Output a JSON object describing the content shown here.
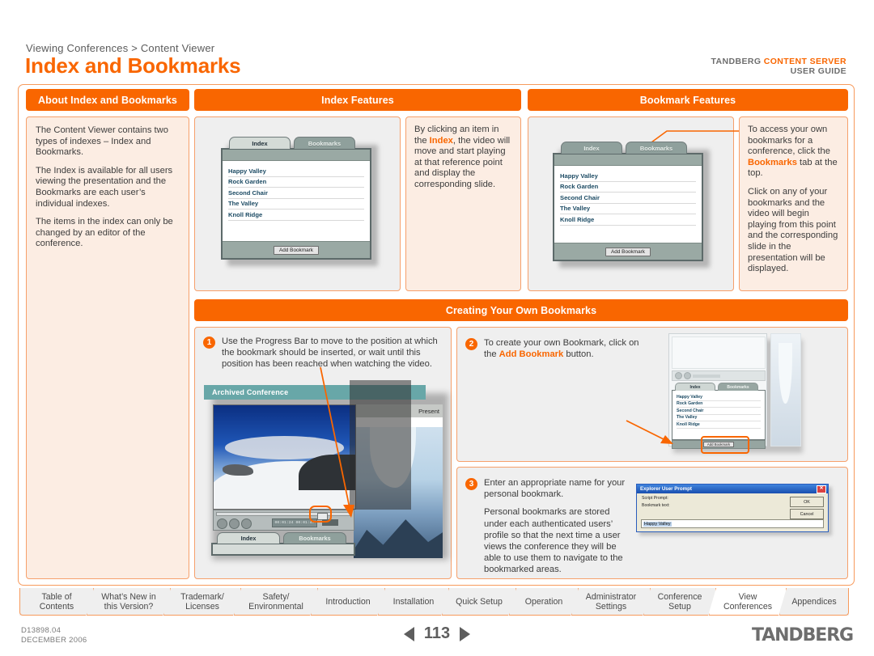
{
  "header": {
    "breadcrumb": "Viewing Conferences > Content Viewer",
    "title": "Index and Bookmarks",
    "brand_line1_prefix": "TANDBERG ",
    "brand_line1_highlight": "CONTENT SERVER",
    "brand_line2": "USER GUIDE"
  },
  "sections": {
    "about": {
      "bar_label": "About Index and Bookmarks",
      "paragraphs": [
        "The Content Viewer contains two types of indexes – Index and Bookmarks.",
        "The Index is available for all users viewing the presentation and the Bookmarks are each user’s individual indexes.",
        "The items in the index can only be changed by an editor of the conference."
      ]
    },
    "index_features": {
      "bar_label": "Index Features",
      "text_pre": "By clicking an item in the ",
      "text_highlight": "Index",
      "text_post": ", the video will move and start playing at that reference point and display the corresponding slide."
    },
    "bookmark_features": {
      "bar_label": "Bookmark Features",
      "p1_pre": "To access your own bookmarks for a conference, click the ",
      "p1_highlight": "Bookmarks",
      "p1_post": " tab at the top.",
      "p2": "Click on any of your bookmarks and the video will begin playing from this point and the corresponding slide in the presentation will be displayed."
    },
    "creating": {
      "bar_label": "Creating Your Own Bookmarks",
      "steps": [
        {
          "number": "1",
          "paragraphs": [
            "Use the Progress Bar to move to the position at which the bookmark should be inserted, or wait until this position has been reached when watching the video."
          ]
        },
        {
          "number": "2",
          "text_pre": "To create your own Bookmark, click on the ",
          "text_highlight": "Add Bookmark",
          "text_post": " button."
        },
        {
          "number": "3",
          "paragraphs": [
            "Enter an appropriate name for your personal bookmark.",
            "Personal bookmarks are stored under each authenticated users’ profile so that the next time a user views the conference they will be able to use them to navigate to the bookmarked areas."
          ]
        }
      ]
    }
  },
  "content_viewer": {
    "tab_index": "Index",
    "tab_bookmarks": "Bookmarks",
    "items": [
      "Happy Valley",
      "Rock Garden",
      "Second Chair",
      "The Valley",
      "Knoll Ridge"
    ],
    "add_bookmark_button": "Add Bookmark"
  },
  "player": {
    "title": "Archived Conference",
    "timecode": "00:01:24 00:01:47",
    "presentation_label": "Present",
    "tab_index": "Index",
    "tab_bookmarks": "Bookmarks"
  },
  "dialog": {
    "title": "Explorer User Prompt",
    "close_glyph": "✕",
    "label_script": "Script Prompt:",
    "label_bookmark": "Bookmark text:",
    "ok_label": "OK",
    "cancel_label": "Cancel",
    "input_value": "Happy Valley"
  },
  "bottom_nav": [
    {
      "label": "Table of\nContents",
      "line1": "Table of",
      "line2": "Contents",
      "active": false
    },
    {
      "label": "What’s New in this Version?",
      "line1": "What’s New in",
      "line2": "this Version?",
      "active": false
    },
    {
      "label": "Trademark/ Licenses",
      "line1": "Trademark/",
      "line2": "Licenses",
      "active": false
    },
    {
      "label": "Safety/ Environmental",
      "line1": "Safety/",
      "line2": "Environmental",
      "active": false
    },
    {
      "label": "Introduction",
      "line1": "Introduction",
      "line2": "",
      "active": false
    },
    {
      "label": "Installation",
      "line1": "Installation",
      "line2": "",
      "active": false
    },
    {
      "label": "Quick Setup",
      "line1": "Quick Setup",
      "line2": "",
      "active": false
    },
    {
      "label": "Operation",
      "line1": "Operation",
      "line2": "",
      "active": false
    },
    {
      "label": "Administrator Settings",
      "line1": "Administrator",
      "line2": "Settings",
      "active": false
    },
    {
      "label": "Conference Setup",
      "line1": "Conference",
      "line2": "Setup",
      "active": false
    },
    {
      "label": "View Conferences",
      "line1": "View",
      "line2": "Conferences",
      "active": true
    },
    {
      "label": "Appendices",
      "line1": "Appendices",
      "line2": "",
      "active": false
    }
  ],
  "footer": {
    "doc_id": "D13898.04",
    "doc_date": "DECEMBER 2006",
    "page_number": "113",
    "prev_label": "◀",
    "next_label": "▶",
    "brand": "TANDBERG"
  },
  "colors": {
    "accent_orange": "#F96600",
    "panel_peach": "#FCEDE3",
    "panel_grey": "#EFEFEF",
    "border_orange": "#F79A5C"
  }
}
